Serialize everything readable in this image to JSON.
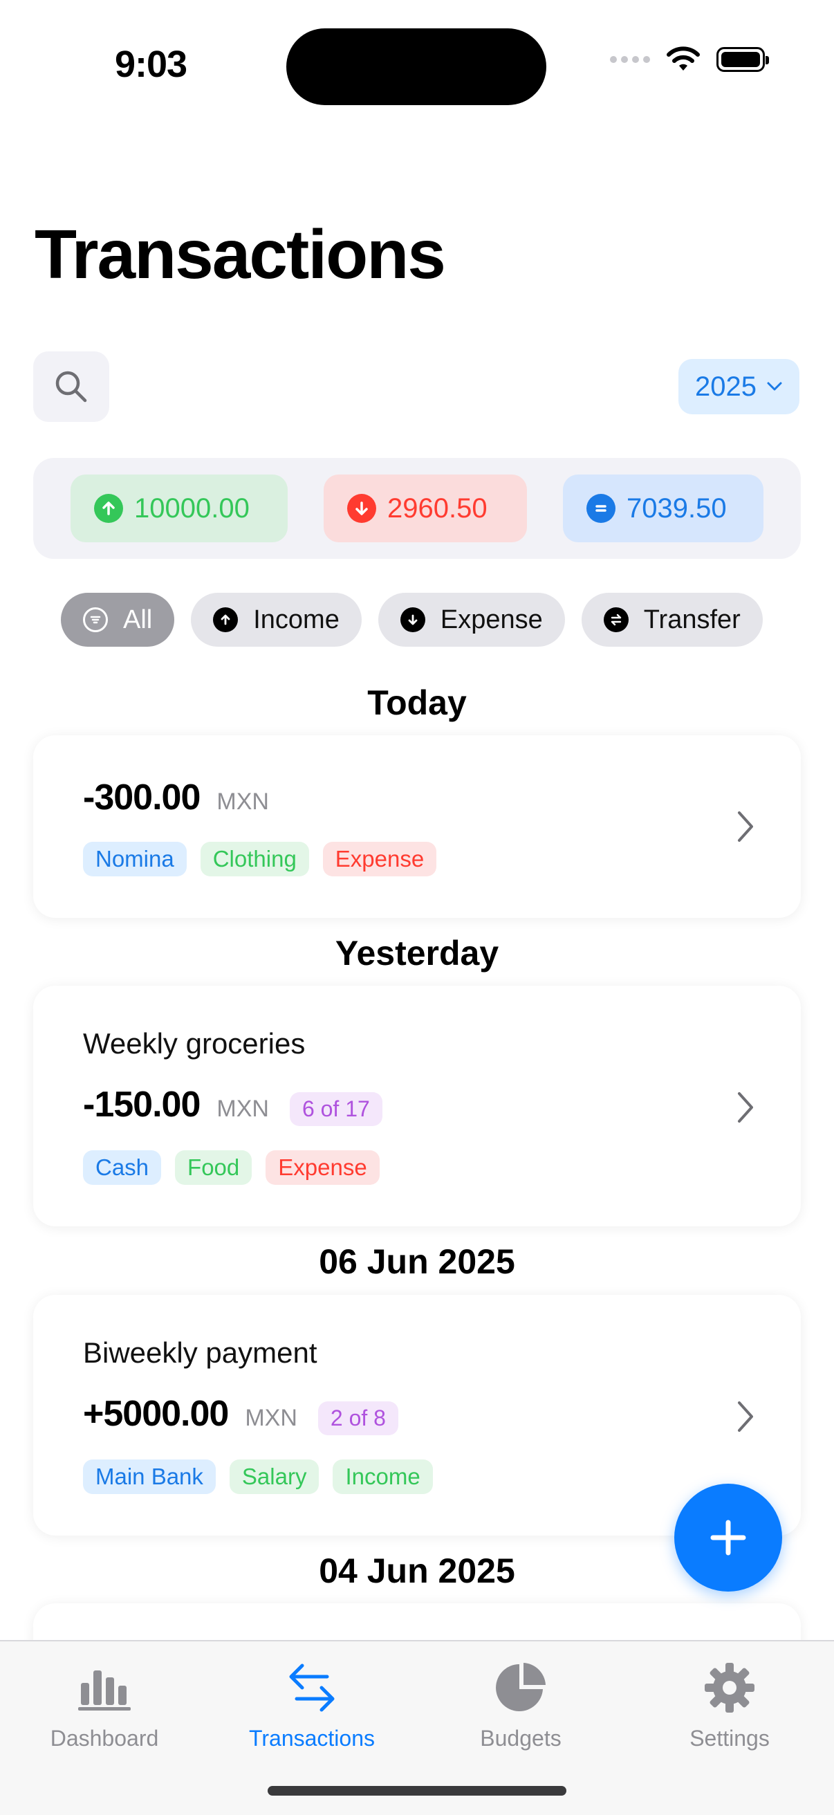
{
  "status_bar": {
    "time": "9:03"
  },
  "header": {
    "title": "Transactions"
  },
  "toolbar": {
    "year": "2025"
  },
  "summary": {
    "income": "10000.00",
    "expense": "2960.50",
    "balance": "7039.50"
  },
  "filters": [
    {
      "label": "All",
      "icon": "list-circle-icon",
      "active": true
    },
    {
      "label": "Income",
      "icon": "arrow-up-circle-icon"
    },
    {
      "label": "Expense",
      "icon": "arrow-down-circle-icon"
    },
    {
      "label": "Transfer",
      "icon": "arrows-swap-circle-icon"
    }
  ],
  "sections": [
    {
      "header": "Today",
      "transactions": [
        {
          "description": "",
          "amount": "-300.00",
          "currency": "MXN",
          "installment": "",
          "tags": [
            "Nomina",
            "Clothing",
            "Expense"
          ]
        }
      ]
    },
    {
      "header": "Yesterday",
      "transactions": [
        {
          "description": "Weekly groceries",
          "amount": "-150.00",
          "currency": "MXN",
          "installment": "6 of 17",
          "tags": [
            "Cash",
            "Food",
            "Expense"
          ]
        }
      ]
    },
    {
      "header": "06 Jun 2025",
      "transactions": [
        {
          "description": "Biweekly payment",
          "amount": "+5000.00",
          "currency": "MXN",
          "installment": "2 of 8",
          "tags": [
            "Main Bank",
            "Salary",
            "Income"
          ]
        }
      ]
    },
    {
      "header": "04 Jun 2025",
      "transactions": []
    }
  ],
  "tab_bar": [
    {
      "label": "Dashboard",
      "icon": "bar-chart-icon"
    },
    {
      "label": "Transactions",
      "icon": "arrows-swap-icon",
      "active": true
    },
    {
      "label": "Budgets",
      "icon": "pie-chart-icon"
    },
    {
      "label": "Settings",
      "icon": "gear-icon"
    }
  ],
  "colors": {
    "accent": "#0a7cff",
    "income": "#34c759",
    "expense": "#ff3b30",
    "installment": "#af52de"
  }
}
